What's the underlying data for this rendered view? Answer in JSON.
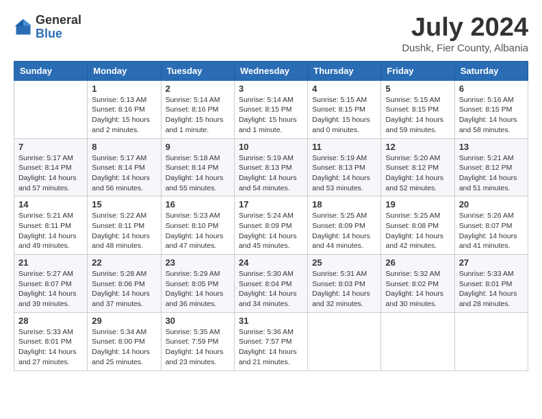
{
  "header": {
    "logo_general": "General",
    "logo_blue": "Blue",
    "month_year": "July 2024",
    "location": "Dushk, Fier County, Albania"
  },
  "calendar": {
    "days_of_week": [
      "Sunday",
      "Monday",
      "Tuesday",
      "Wednesday",
      "Thursday",
      "Friday",
      "Saturday"
    ],
    "weeks": [
      [
        {
          "day": "",
          "info": ""
        },
        {
          "day": "1",
          "info": "Sunrise: 5:13 AM\nSunset: 8:16 PM\nDaylight: 15 hours\nand 2 minutes."
        },
        {
          "day": "2",
          "info": "Sunrise: 5:14 AM\nSunset: 8:16 PM\nDaylight: 15 hours\nand 1 minute."
        },
        {
          "day": "3",
          "info": "Sunrise: 5:14 AM\nSunset: 8:15 PM\nDaylight: 15 hours\nand 1 minute."
        },
        {
          "day": "4",
          "info": "Sunrise: 5:15 AM\nSunset: 8:15 PM\nDaylight: 15 hours\nand 0 minutes."
        },
        {
          "day": "5",
          "info": "Sunrise: 5:15 AM\nSunset: 8:15 PM\nDaylight: 14 hours\nand 59 minutes."
        },
        {
          "day": "6",
          "info": "Sunrise: 5:16 AM\nSunset: 8:15 PM\nDaylight: 14 hours\nand 58 minutes."
        }
      ],
      [
        {
          "day": "7",
          "info": "Sunrise: 5:17 AM\nSunset: 8:14 PM\nDaylight: 14 hours\nand 57 minutes."
        },
        {
          "day": "8",
          "info": "Sunrise: 5:17 AM\nSunset: 8:14 PM\nDaylight: 14 hours\nand 56 minutes."
        },
        {
          "day": "9",
          "info": "Sunrise: 5:18 AM\nSunset: 8:14 PM\nDaylight: 14 hours\nand 55 minutes."
        },
        {
          "day": "10",
          "info": "Sunrise: 5:19 AM\nSunset: 8:13 PM\nDaylight: 14 hours\nand 54 minutes."
        },
        {
          "day": "11",
          "info": "Sunrise: 5:19 AM\nSunset: 8:13 PM\nDaylight: 14 hours\nand 53 minutes."
        },
        {
          "day": "12",
          "info": "Sunrise: 5:20 AM\nSunset: 8:12 PM\nDaylight: 14 hours\nand 52 minutes."
        },
        {
          "day": "13",
          "info": "Sunrise: 5:21 AM\nSunset: 8:12 PM\nDaylight: 14 hours\nand 51 minutes."
        }
      ],
      [
        {
          "day": "14",
          "info": "Sunrise: 5:21 AM\nSunset: 8:11 PM\nDaylight: 14 hours\nand 49 minutes."
        },
        {
          "day": "15",
          "info": "Sunrise: 5:22 AM\nSunset: 8:11 PM\nDaylight: 14 hours\nand 48 minutes."
        },
        {
          "day": "16",
          "info": "Sunrise: 5:23 AM\nSunset: 8:10 PM\nDaylight: 14 hours\nand 47 minutes."
        },
        {
          "day": "17",
          "info": "Sunrise: 5:24 AM\nSunset: 8:09 PM\nDaylight: 14 hours\nand 45 minutes."
        },
        {
          "day": "18",
          "info": "Sunrise: 5:25 AM\nSunset: 8:09 PM\nDaylight: 14 hours\nand 44 minutes."
        },
        {
          "day": "19",
          "info": "Sunrise: 5:25 AM\nSunset: 8:08 PM\nDaylight: 14 hours\nand 42 minutes."
        },
        {
          "day": "20",
          "info": "Sunrise: 5:26 AM\nSunset: 8:07 PM\nDaylight: 14 hours\nand 41 minutes."
        }
      ],
      [
        {
          "day": "21",
          "info": "Sunrise: 5:27 AM\nSunset: 8:07 PM\nDaylight: 14 hours\nand 39 minutes."
        },
        {
          "day": "22",
          "info": "Sunrise: 5:28 AM\nSunset: 8:06 PM\nDaylight: 14 hours\nand 37 minutes."
        },
        {
          "day": "23",
          "info": "Sunrise: 5:29 AM\nSunset: 8:05 PM\nDaylight: 14 hours\nand 36 minutes."
        },
        {
          "day": "24",
          "info": "Sunrise: 5:30 AM\nSunset: 8:04 PM\nDaylight: 14 hours\nand 34 minutes."
        },
        {
          "day": "25",
          "info": "Sunrise: 5:31 AM\nSunset: 8:03 PM\nDaylight: 14 hours\nand 32 minutes."
        },
        {
          "day": "26",
          "info": "Sunrise: 5:32 AM\nSunset: 8:02 PM\nDaylight: 14 hours\nand 30 minutes."
        },
        {
          "day": "27",
          "info": "Sunrise: 5:33 AM\nSunset: 8:01 PM\nDaylight: 14 hours\nand 28 minutes."
        }
      ],
      [
        {
          "day": "28",
          "info": "Sunrise: 5:33 AM\nSunset: 8:01 PM\nDaylight: 14 hours\nand 27 minutes."
        },
        {
          "day": "29",
          "info": "Sunrise: 5:34 AM\nSunset: 8:00 PM\nDaylight: 14 hours\nand 25 minutes."
        },
        {
          "day": "30",
          "info": "Sunrise: 5:35 AM\nSunset: 7:59 PM\nDaylight: 14 hours\nand 23 minutes."
        },
        {
          "day": "31",
          "info": "Sunrise: 5:36 AM\nSunset: 7:57 PM\nDaylight: 14 hours\nand 21 minutes."
        },
        {
          "day": "",
          "info": ""
        },
        {
          "day": "",
          "info": ""
        },
        {
          "day": "",
          "info": ""
        }
      ]
    ]
  }
}
